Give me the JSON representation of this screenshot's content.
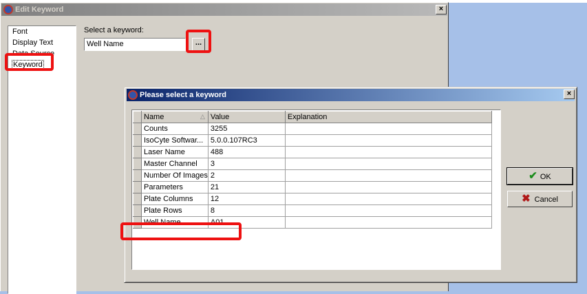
{
  "edit_dialog": {
    "title": "Edit Keyword",
    "close_label": "×",
    "nav_items": [
      "Font",
      "Display Text",
      "Data Source",
      "Keyword"
    ],
    "selected_nav": "Keyword",
    "keyword_label": "Select a keyword:",
    "keyword_value": "Well Name",
    "browse_label": "..."
  },
  "select_dialog": {
    "title": "Please select a keyword",
    "close_label": "×",
    "columns": [
      "Name",
      "Value",
      "Explanation"
    ],
    "rows": [
      {
        "name": "Counts",
        "value": "3255",
        "explanation": ""
      },
      {
        "name": "IsoCyte Softwar...",
        "value": "5.0.0.107RC3",
        "explanation": ""
      },
      {
        "name": "Laser Name",
        "value": "488",
        "explanation": ""
      },
      {
        "name": "Master Channel",
        "value": "3",
        "explanation": ""
      },
      {
        "name": "Number Of Images",
        "value": "2",
        "explanation": ""
      },
      {
        "name": "Parameters",
        "value": "21",
        "explanation": ""
      },
      {
        "name": "Plate Columns",
        "value": "12",
        "explanation": ""
      },
      {
        "name": "Plate Rows",
        "value": "8",
        "explanation": ""
      },
      {
        "name": "Well Name",
        "value": "A01",
        "explanation": ""
      }
    ],
    "ok_label": "OK",
    "cancel_label": "Cancel"
  },
  "colors": {
    "annotation_red": "#ee1111",
    "active_title": "#0a246a",
    "inactive_title": "#808080",
    "ok_icon": "#1c8c1c",
    "cancel_icon": "#b01818"
  },
  "icons": [
    "app-icon",
    "checkmark-icon",
    "cross-icon",
    "sort-ascending-icon"
  ]
}
